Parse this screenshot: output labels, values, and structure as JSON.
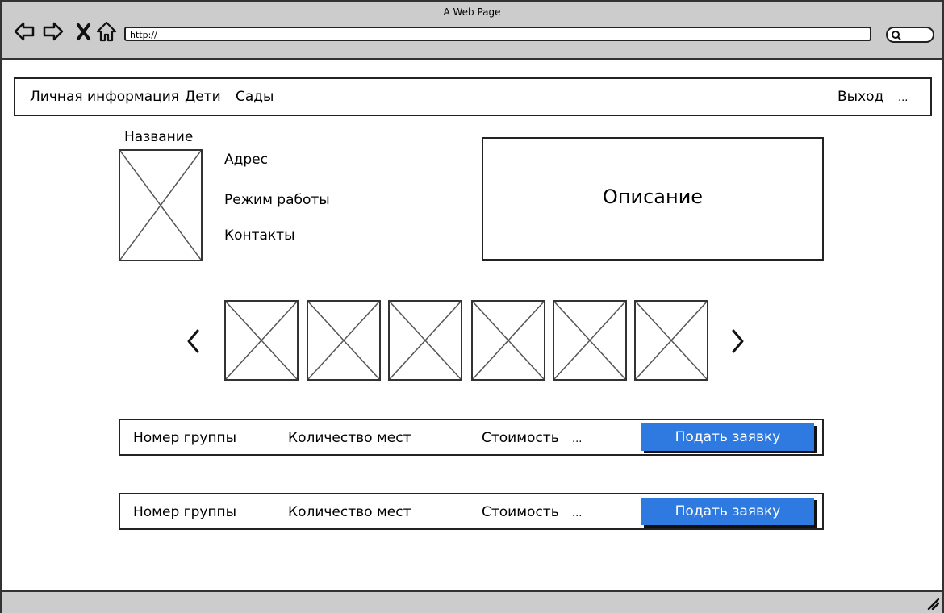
{
  "window": {
    "title": "A Web Page",
    "url": "http://"
  },
  "icons": [
    "back-arrow-icon",
    "forward-arrow-icon",
    "close-icon",
    "home-icon",
    "search-icon",
    "resize-grip-icon",
    "image-placeholder-icon",
    "chevron-left-icon",
    "chevron-right-icon"
  ],
  "colors": {
    "accent": "#2f7ae0",
    "chrome": "#cccccc",
    "border": "#222222"
  },
  "nav": {
    "items": [
      "Личная информация",
      "Дети",
      "Сады"
    ],
    "logout": "Выход",
    "more": "..."
  },
  "kindergarten": {
    "name_label": "Название",
    "address": "Адрес",
    "hours": "Режим работы",
    "contacts": "Контакты",
    "description": "Описание"
  },
  "groups": [
    {
      "number": "Номер группы",
      "seats": "Количество мест",
      "cost": "Стоимость",
      "more": "...",
      "apply": "Подать заявку"
    },
    {
      "number": "Номер группы",
      "seats": "Количество мест",
      "cost": "Стоимость",
      "more": "...",
      "apply": "Подать заявку"
    }
  ]
}
